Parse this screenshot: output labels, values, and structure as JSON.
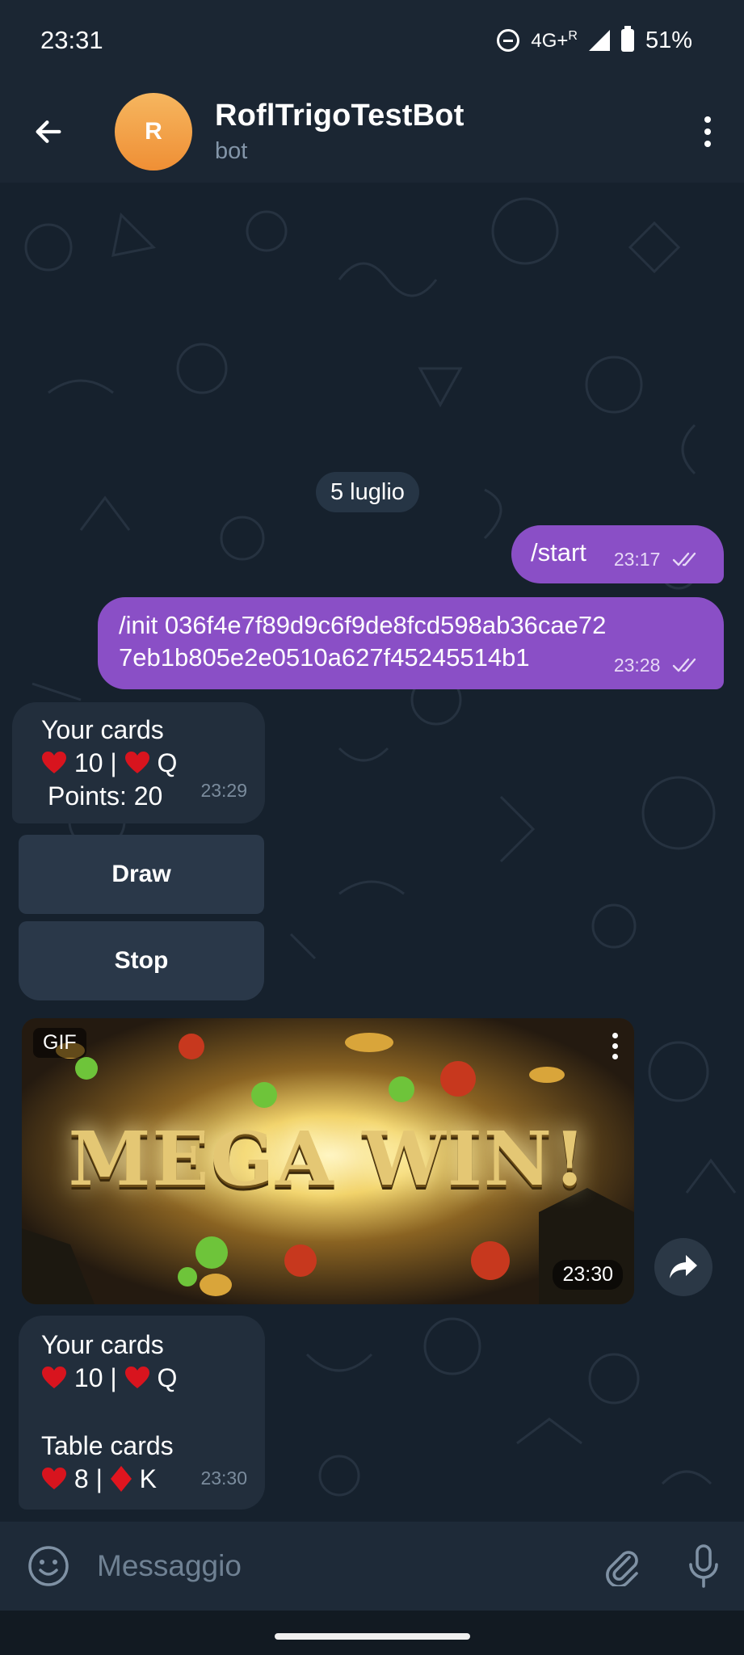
{
  "status": {
    "time": "23:31",
    "network": "4G+",
    "roaming": "R",
    "battery": "51%"
  },
  "header": {
    "avatar_letter": "R",
    "title": "RoflTrigoTestBot",
    "subtitle": "bot"
  },
  "chat": {
    "date": "5 luglio",
    "out1": {
      "text": "/start",
      "time": "23:17"
    },
    "out2": {
      "line1": "/init 036f4e7f89d9c6f9de8fcd598ab36cae72",
      "line2": "7eb1b805e2e0510a627f45245514b1",
      "time": "23:28"
    },
    "in1": {
      "title": "Your cards",
      "card1": "10",
      "card2": "Q",
      "points": "Points: 20",
      "time": "23:29"
    },
    "buttons": {
      "draw": "Draw",
      "stop": "Stop"
    },
    "gif": {
      "label": "GIF",
      "caption": "MEGA WIN!",
      "time": "23:30"
    },
    "in2": {
      "title": "Your cards",
      "card1": "10",
      "card2": "Q",
      "table_title": "Table cards",
      "table1": "8",
      "table2": "K",
      "time": "23:30"
    }
  },
  "composer": {
    "placeholder": "Messaggio"
  },
  "colors": {
    "outgoing": "#8a4fc6",
    "incoming": "#222e3c",
    "header": "#1b2633",
    "avatar": "#f0a348"
  }
}
